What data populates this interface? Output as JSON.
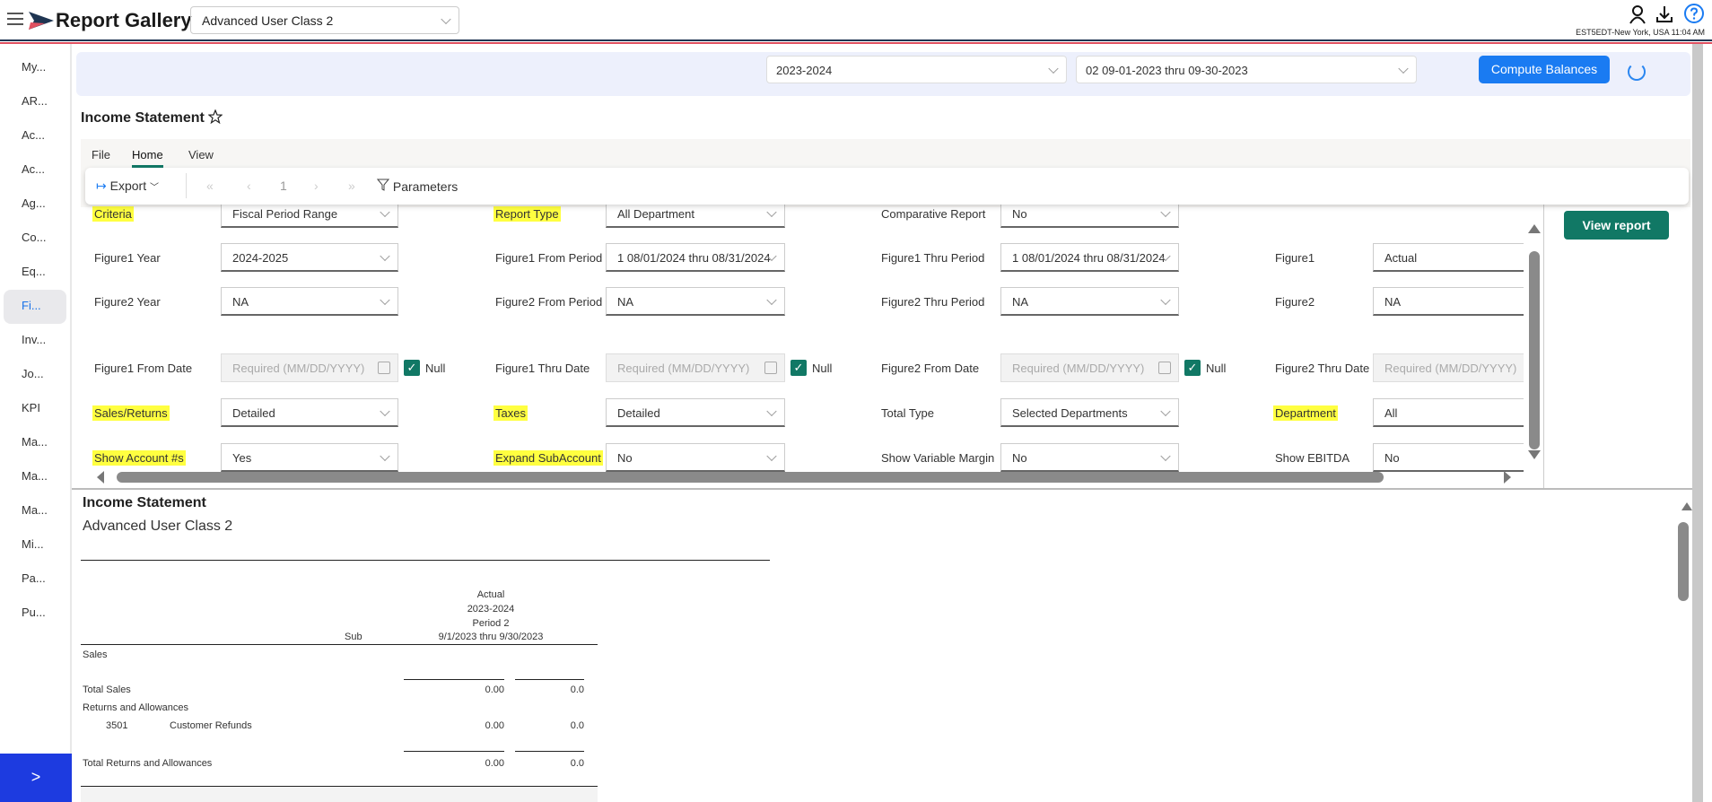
{
  "header": {
    "app_title": "Report Gallery",
    "class_select": "Advanced User Class 2",
    "timezone": "EST5EDT-New York, USA 11:04 AM",
    "icons": [
      "menu-icon",
      "logo-arrow-icon",
      "user-icon",
      "download-icon",
      "help-icon"
    ]
  },
  "sidebar": {
    "items": [
      "My...",
      "AR...",
      "Ac...",
      "Ac...",
      "Ag...",
      "Co...",
      "Eq...",
      "Fi...",
      "Inv...",
      "Jo...",
      "KPI",
      "Ma...",
      "Ma...",
      "Ma...",
      "Mi...",
      "Pa...",
      "Pu..."
    ],
    "selected_index": 7,
    "expand_label": ">"
  },
  "topbar": {
    "year": "2023-2024",
    "period": "02 09-01-2023 thru 09-30-2023",
    "compute_label": "Compute Balances"
  },
  "page": {
    "title": "Income Statement"
  },
  "ribbon": {
    "tabs": [
      "File",
      "Home",
      "View"
    ],
    "selected_tab": "Home",
    "export_label": "Export",
    "page_number": "1",
    "parameters_label": "Parameters"
  },
  "params": {
    "view_report_label": "View report",
    "null_label": "Null",
    "rows": [
      [
        {
          "label": "Criteria",
          "value": "Fiscal Period Range",
          "type": "select",
          "hl": true
        },
        {
          "label": "Report Type",
          "value": "All Department",
          "type": "select",
          "hl": true
        },
        {
          "label": "Comparative Report",
          "value": "No",
          "type": "select"
        },
        null
      ],
      [
        {
          "label": "Figure1 Year",
          "value": "2024-2025",
          "type": "select"
        },
        {
          "label": "Figure1 From Period",
          "value": "1 08/01/2024 thru 08/31/2024",
          "type": "select"
        },
        {
          "label": "Figure1 Thru Period",
          "value": "1 08/01/2024 thru 08/31/2024",
          "type": "select"
        },
        {
          "label": "Figure1",
          "value": "Actual",
          "type": "text"
        }
      ],
      [
        {
          "label": "Figure2 Year",
          "value": "NA",
          "type": "select"
        },
        {
          "label": "Figure2 From Period",
          "value": "NA",
          "type": "select"
        },
        {
          "label": "Figure2 Thru Period",
          "value": "NA",
          "type": "select"
        },
        {
          "label": "Figure2",
          "value": "NA",
          "type": "text"
        }
      ],
      [
        {
          "label": "Figure1 From Date",
          "value": "Required (MM/DD/YYYY)",
          "type": "date",
          "null": true
        },
        {
          "label": "Figure1 Thru Date",
          "value": "Required (MM/DD/YYYY)",
          "type": "date",
          "null": true
        },
        {
          "label": "Figure2 From Date",
          "value": "Required (MM/DD/YYYY)",
          "type": "date",
          "null": true
        },
        {
          "label": "Figure2 Thru Date",
          "value": "Required (MM/DD/YYYY)",
          "type": "date"
        }
      ],
      [
        {
          "label": "Sales/Returns",
          "value": "Detailed",
          "type": "select",
          "hl": true
        },
        {
          "label": "Taxes",
          "value": "Detailed",
          "type": "select",
          "hl": true
        },
        {
          "label": "Total Type",
          "value": "Selected Departments",
          "type": "select"
        },
        {
          "label": "Department",
          "value": "All",
          "type": "text",
          "hl": true
        }
      ],
      [
        {
          "label": "Show Account #s",
          "value": "Yes",
          "type": "select",
          "hl": true
        },
        {
          "label": "Expand SubAccount",
          "value": "No",
          "type": "select",
          "hl": true
        },
        {
          "label": "Show Variable Margin",
          "value": "No",
          "type": "select"
        },
        {
          "label": "Show EBITDA",
          "value": "No",
          "type": "text"
        }
      ]
    ]
  },
  "report": {
    "title": "Income Statement",
    "subtitle": "Advanced User Class 2",
    "col_sub": "Sub",
    "col_header": [
      "Actual",
      "2023-2024",
      "Period 2",
      "9/1/2023 thru 9/30/2023"
    ],
    "rows": [
      {
        "label": "Sales"
      },
      {
        "label": "Total Sales",
        "v1": "0.00",
        "v2": "0.0"
      },
      {
        "label": "Returns and Allowances"
      },
      {
        "acct": "3501",
        "label": "Customer Refunds",
        "v1": "0.00",
        "v2": "0.0"
      },
      {
        "label": "Total Returns and Allowances",
        "v1": "0.00",
        "v2": "0.0"
      }
    ]
  },
  "colors": {
    "accent_green": "#117865",
    "primary_blue": "#1a7bf2",
    "highlight": "#ffff40",
    "sidebar_button": "#1d3be0"
  }
}
